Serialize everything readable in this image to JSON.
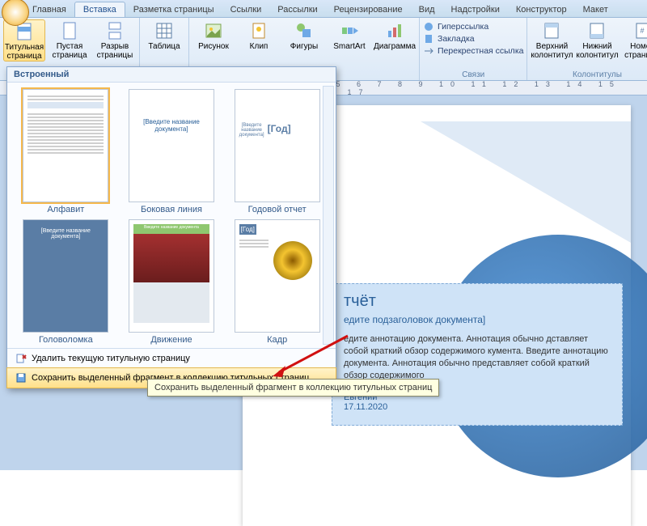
{
  "tabs": [
    "Главная",
    "Вставка",
    "Разметка страницы",
    "Ссылки",
    "Рассылки",
    "Рецензирование",
    "Вид",
    "Надстройки",
    "Конструктор",
    "Макет"
  ],
  "active_tab": "Вставка",
  "ribbon": {
    "pages": {
      "title_page": "Титульная страница",
      "blank_page": "Пустая страница",
      "page_break": "Разрыв страницы"
    },
    "tables": {
      "table": "Таблица"
    },
    "illustrations": {
      "picture": "Рисунок",
      "clip": "Клип",
      "shapes": "Фигуры",
      "smartart": "SmartArt",
      "chart": "Диаграмма"
    },
    "links": {
      "hyperlink": "Гиперссылка",
      "bookmark": "Закладка",
      "crossref": "Перекрестная ссылка",
      "group": "Связи"
    },
    "headerfooter": {
      "header": "Верхний колонтитул",
      "footer": "Нижний колонтитул",
      "pagenum": "Номер страницы",
      "group": "Колонтитулы"
    }
  },
  "gallery": {
    "header": "Встроенный",
    "items": [
      {
        "label": "Алфавит"
      },
      {
        "label": "Боковая линия"
      },
      {
        "label": "Годовой отчет"
      },
      {
        "label": "Головоломка"
      },
      {
        "label": "Движение"
      },
      {
        "label": "Кадр"
      }
    ],
    "remove": "Удалить текущую титульную страницу",
    "save": "Сохранить выделенный фрагмент в коллекцию титульных страниц…",
    "tooltip": "Сохранить выделенный фрагмент в коллекцию титульных страниц"
  },
  "doc": {
    "title": "тчёт",
    "subtitle": "едите подзаголовок документа]",
    "body": "едите аннотацию документа. Аннотация обычно дставляет собой краткий обзор содержимого кумента. Введите аннотацию документа. Аннотация обычно представляет собой краткий обзор содержимого",
    "author": "Евгений",
    "date": "17.11.2020"
  },
  "ruler_marks": "4 5 6 7 8 9 10 11 12 13 14 15 16 17"
}
